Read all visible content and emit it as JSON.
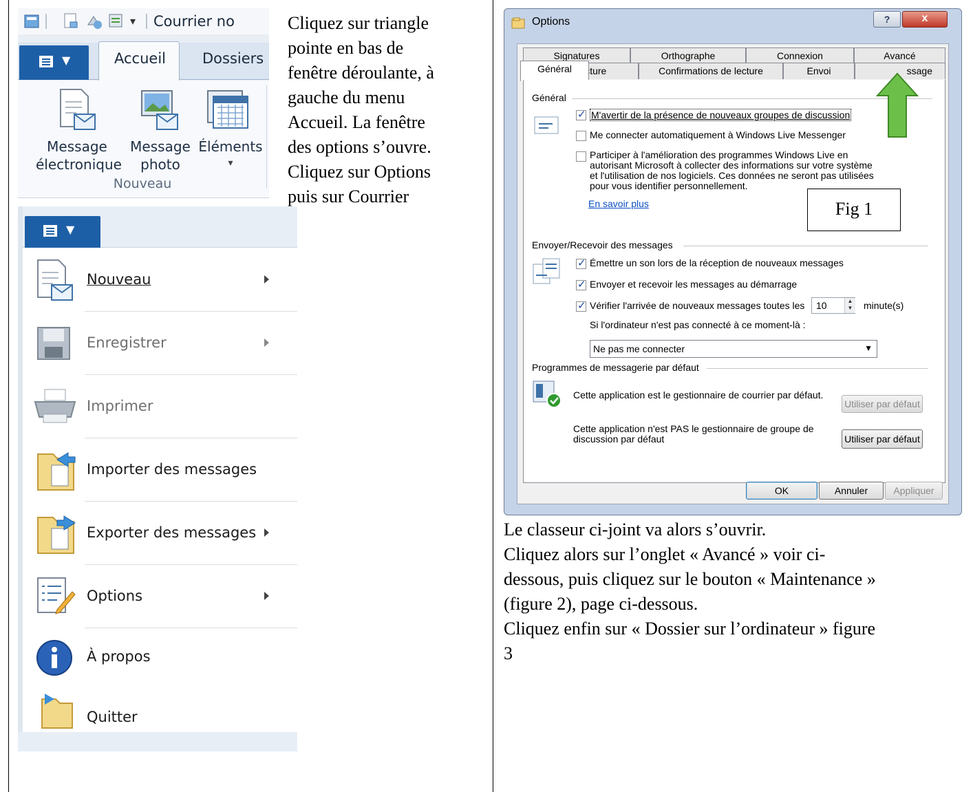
{
  "ribbon": {
    "qat_title": "Courrier no",
    "tabs": [
      "Accueil",
      "Dossiers"
    ],
    "buttons": [
      {
        "label1": "Message",
        "label2": "électronique"
      },
      {
        "label1": "Message",
        "label2": "photo"
      },
      {
        "label1": "Éléments",
        "label2": "▾"
      }
    ],
    "group_label": "Nouveau"
  },
  "instructions_top": [
    "Cliquez sur triangle",
    "pointe en bas de",
    "fenêtre déroulante, à",
    "gauche du menu",
    "Accueil. La fenêtre",
    "des options s’ouvre.",
    "Cliquez sur Options",
    "puis sur Courrier"
  ],
  "file_menu": {
    "items": [
      {
        "label": "Nouveau",
        "access": "N",
        "rest": "ouveau",
        "has_arrow": true,
        "disabled": false
      },
      {
        "label": "Enregistrer",
        "has_arrow": true,
        "disabled": true
      },
      {
        "label": "Imprimer",
        "has_arrow": false,
        "disabled": true
      },
      {
        "label": "Importer des messages",
        "has_arrow": false,
        "disabled": false
      },
      {
        "label": "Exporter des messages",
        "has_arrow": true,
        "disabled": false
      },
      {
        "label": "Options",
        "has_arrow": true,
        "disabled": false
      },
      {
        "label": "À propos",
        "has_arrow": false,
        "disabled": false
      },
      {
        "label": "Quitter",
        "has_arrow": false,
        "disabled": false
      }
    ]
  },
  "dialog": {
    "title": "Options",
    "help": "?",
    "close": "x",
    "tabs_row1": [
      "Signatures",
      "Orthographe",
      "Connexion",
      "Avancé"
    ],
    "tabs_row2": [
      "Général",
      "Lecture",
      "Confirmations de lecture",
      "Envoi",
      "Message"
    ],
    "tab_row2_visible_last": "ssage",
    "group_general": "Général",
    "opt_newsgroups": "M'avertir de la présence de nouveaux groupes de discussion",
    "opt_messenger": "Me connecter automatiquement à Windows Live Messenger",
    "opt_improve": [
      "Participer à l'amélioration des programmes Windows Live en",
      "autorisant Microsoft à collecter des informations sur votre système",
      "et l'utilisation de nos logiciels. Ces données ne seront pas utilisées",
      "pour vous identifier personnellement."
    ],
    "link_more": "En savoir plus",
    "fig_label": "Fig 1",
    "group_send": "Envoyer/Recevoir des messages",
    "opt_sound": "Émettre un son lors de la réception de nouveaux messages",
    "opt_startup": "Envoyer et recevoir les messages au démarrage",
    "opt_check": "Vérifier l'arrivée de nouveaux messages toutes les",
    "check_value": "10",
    "check_unit": "minute(s)",
    "not_connected": "Si l'ordinateur n'est pas connecté à ce moment-là :",
    "connect_select": "Ne pas me connecter",
    "group_default": "Programmes de messagerie par défaut",
    "default_mail": "Cette application est le gestionnaire de courrier par défaut.",
    "default_news": [
      "Cette application n'est PAS le gestionnaire de groupe de",
      "discussion par défaut"
    ],
    "btn_default": "Utiliser par défaut",
    "btn_ok": "OK",
    "btn_cancel": "Annuler",
    "btn_apply": "Appliquer"
  },
  "instructions_right": [
    "Le classeur ci-joint va alors s’ouvrir.",
    "Cliquez alors sur l’onglet « Avancé » voir ci-",
    "dessous, puis cliquez sur le bouton « Maintenance »",
    "(figure 2), page ci-dessous.",
    "Cliquez enfin sur « Dossier sur l’ordinateur » figure",
    "3"
  ],
  "colors": {
    "accent_blue": "#1d5fa7",
    "green_arrow": "#5fbf3a"
  }
}
